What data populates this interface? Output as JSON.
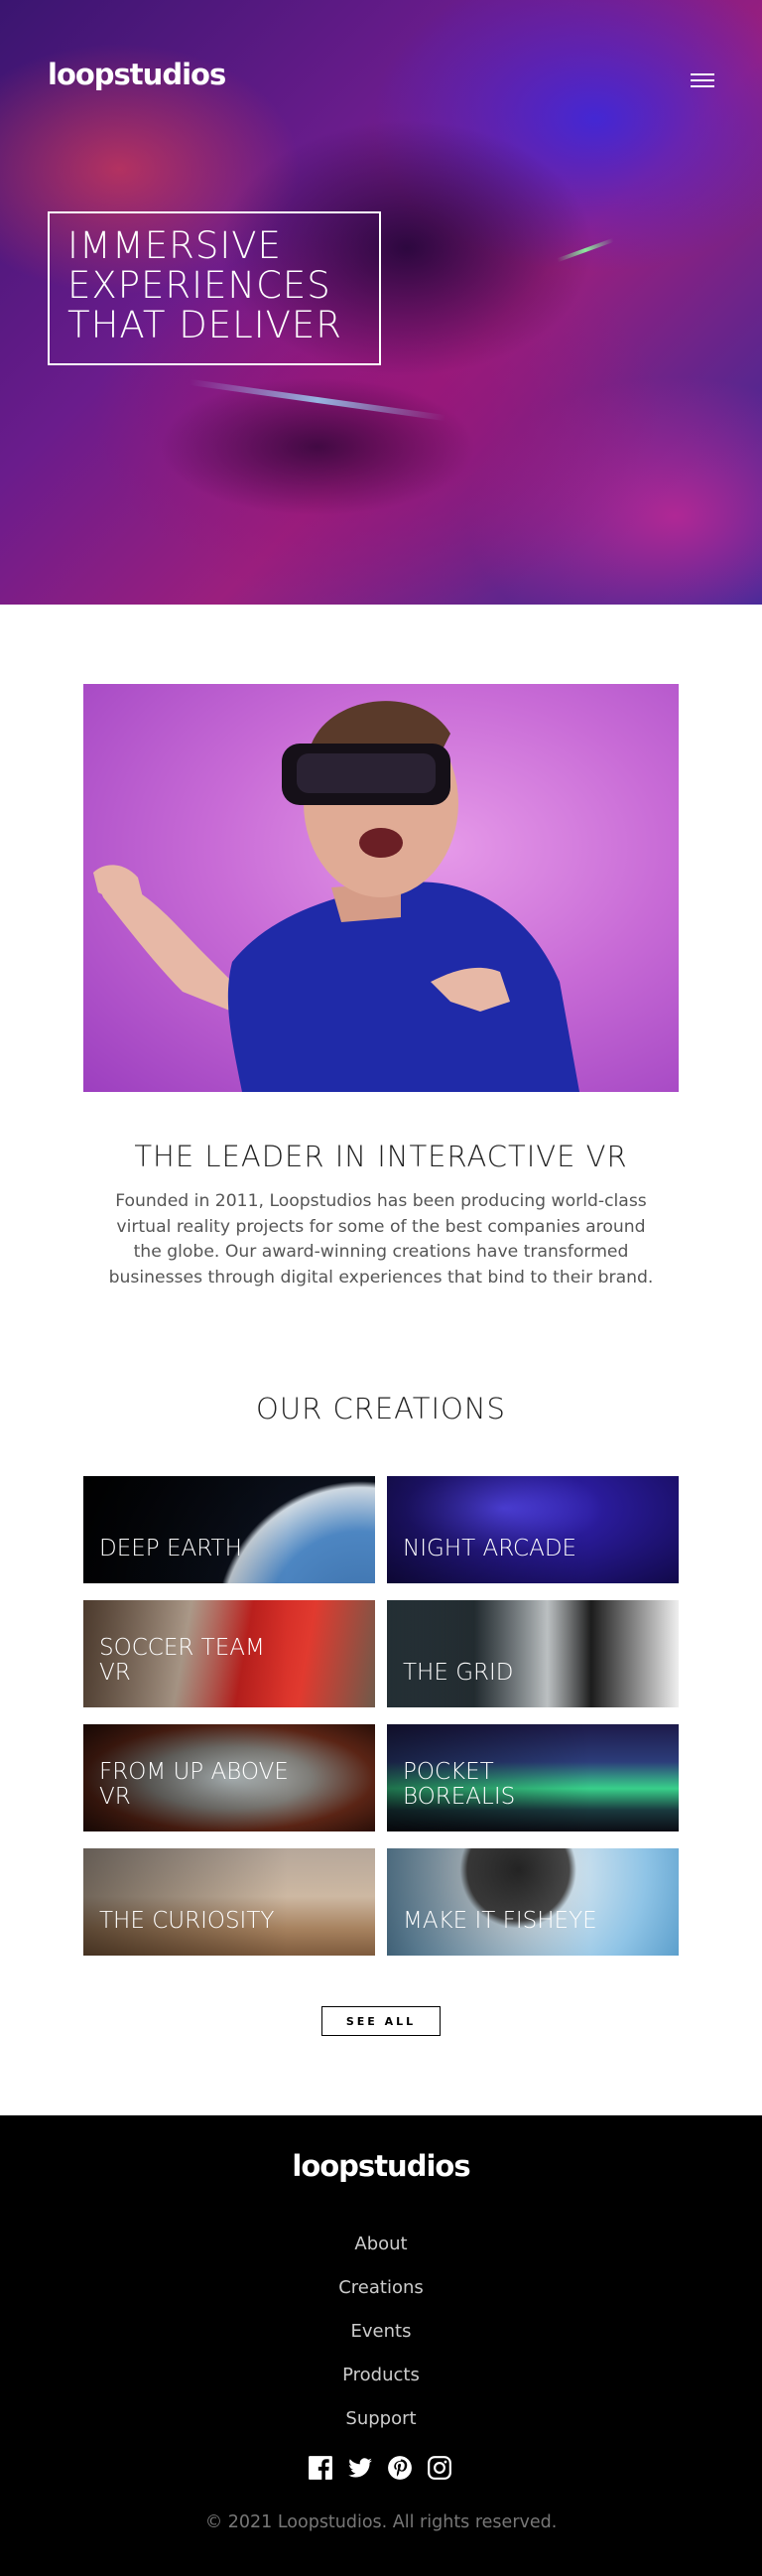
{
  "header": {
    "logo": "loopstudios",
    "menu_icon": "hamburger-icon"
  },
  "hero": {
    "title": "IMMERSIVE EXPERIENCES THAT DELIVER"
  },
  "interactive": {
    "title": "THE LEADER IN INTERACTIVE VR",
    "text": "Founded in 2011, Loopstudios has been producing world-class virtual reality projects for some of the best companies around the globe. Our award-winning creations have transformed businesses through digital experiences that bind to their brand."
  },
  "creations": {
    "title": "OUR CREATIONS",
    "items": [
      {
        "label": "DEEP EARTH"
      },
      {
        "label": "NIGHT ARCADE"
      },
      {
        "label": "SOCCER TEAM VR"
      },
      {
        "label": "THE GRID"
      },
      {
        "label": "FROM UP ABOVE VR"
      },
      {
        "label": "POCKET BOREALIS"
      },
      {
        "label": "THE CURIOSITY"
      },
      {
        "label": "MAKE IT FISHEYE"
      }
    ],
    "see_all_label": "SEE ALL"
  },
  "footer": {
    "logo": "loopstudios",
    "links": [
      "About",
      "Creations",
      "Events",
      "Products",
      "Support"
    ],
    "social_icons": [
      "facebook-icon",
      "twitter-icon",
      "pinterest-icon",
      "instagram-icon"
    ],
    "copyright": "© 2021 Loopstudios. All rights reserved."
  },
  "colors": {
    "footer_bg": "#000000",
    "text": "#000000",
    "muted": "#555555"
  }
}
